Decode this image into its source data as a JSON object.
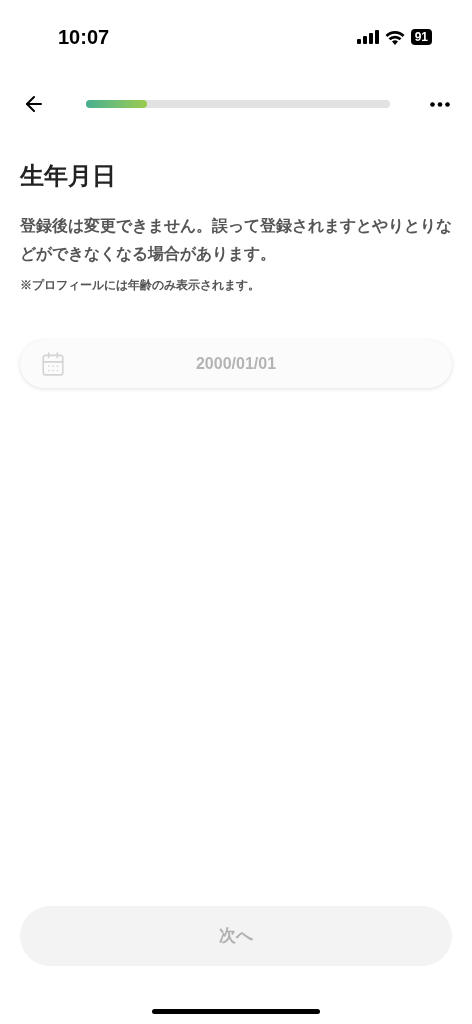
{
  "status_bar": {
    "time": "10:07",
    "battery": "91"
  },
  "nav": {
    "progress": {
      "level": 0.2
    }
  },
  "title": "生年月日",
  "description": "登録後は変更できません。誤って登録されますとやりとりなどができなくなる場合があります。",
  "note": "※プロフィールには年齢のみ表示されます。",
  "date_field": {
    "placeholder": "2000/01/01"
  },
  "next_button": {
    "label": "次へ",
    "disabled": true
  }
}
